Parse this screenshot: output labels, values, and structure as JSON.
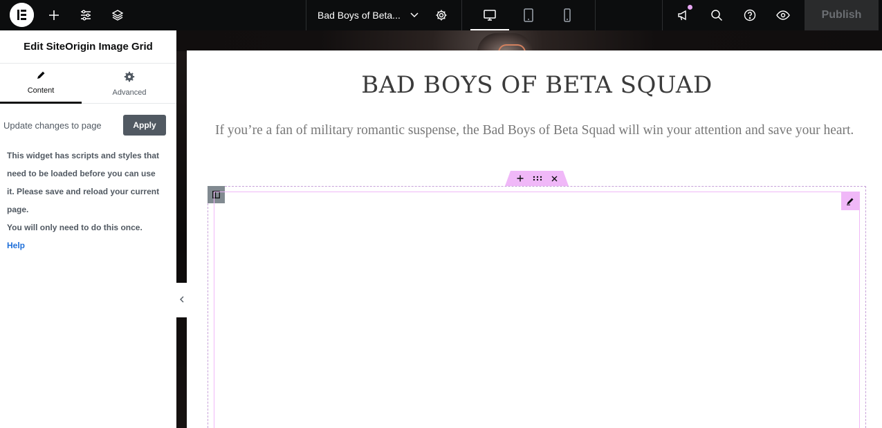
{
  "topbar": {
    "logo_icon": "elementor-logo-icon",
    "add_icon": "plus-icon",
    "settings_icon": "sliders-icon",
    "structure_icon": "layers-icon",
    "document_title": "Bad Boys of Beta...",
    "publish_label": "Publish"
  },
  "panel": {
    "title": "Edit SiteOrigin Image Grid",
    "tabs": [
      {
        "label": "Content",
        "icon": "pencil-icon"
      },
      {
        "label": "Advanced",
        "icon": "gear-icon"
      }
    ],
    "update_label": "Update changes to page",
    "apply_label": "Apply",
    "notice_lines": [
      "This widget has scripts and styles that",
      "need to be loaded before you can use",
      "it. Please save and reload your current",
      "page.",
      "You will only need to do this once."
    ],
    "help_label": "Help"
  },
  "canvas": {
    "heading": "BAD BOYS OF BETA SQUAD",
    "paragraph": "If you’re a fan of military romantic suspense, the Bad Boys of Beta Squad will win your attention and save your heart."
  },
  "colors": {
    "topbar_bg": "#0c0d0e",
    "accent_pink": "#f0b8f8",
    "apply_bg": "#515962",
    "link_blue": "#1e6fd9"
  }
}
